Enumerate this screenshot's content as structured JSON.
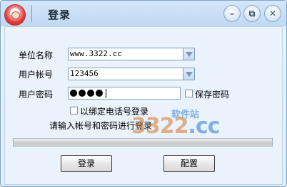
{
  "window": {
    "title": "登录",
    "controls": {
      "minimize": "–",
      "maximize": "⧉",
      "close": "✕"
    }
  },
  "form": {
    "unit_label": "单位名称",
    "unit_value": "www.3322.cc",
    "account_label": "用户帐号",
    "account_value": "123456",
    "password_label": "用户密码",
    "save_password_label": "保存密码",
    "bind_label": "以绑定电话号登录"
  },
  "status_hint": "请输入帐号和密码进行登录",
  "buttons": {
    "login": "登录",
    "config": "配置"
  },
  "watermark": {
    "main": "3322",
    "cc": ".cc",
    "sub": "软件站"
  },
  "colors": {
    "titlebar": "#c9ddf5",
    "background": "#eaf2fb",
    "border": "#7b9ebd"
  }
}
